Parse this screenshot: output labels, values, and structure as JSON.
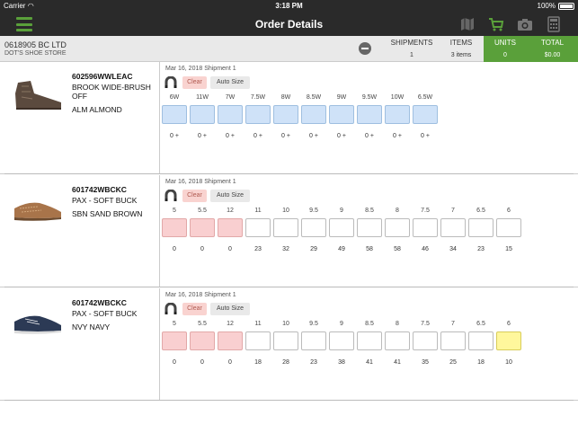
{
  "status_bar": {
    "carrier": "Carrier",
    "time": "3:18 PM",
    "battery": "100%"
  },
  "nav": {
    "title": "Order Details",
    "icons": [
      "menu-icon",
      "map-icon",
      "cart-icon",
      "camera-icon",
      "calculator-icon"
    ],
    "accent_color": "#5aa03a"
  },
  "customer": {
    "name": "0618905 BC LTD",
    "store": "DOT'S SHOE STORE",
    "shipments_label": "SHIPMENTS",
    "shipments_value": "1",
    "items_label": "ITEMS",
    "items_value": "3 items",
    "units_label": "UNITS",
    "units_value": "0",
    "total_label": "TOTAL",
    "total_value": "$0.00"
  },
  "products": [
    {
      "sku": "602596WWLEAC",
      "name": "BROOK WIDE-BRUSH OFF",
      "color": "ALM ALMOND",
      "shipment": "Mar 16, 2018 Shipment 1",
      "clear_label": "Clear",
      "auto_label": "Auto Size",
      "sizes": [
        {
          "label": "6W",
          "qty": "0 +",
          "state": "blue"
        },
        {
          "label": "11W",
          "qty": "0 +",
          "state": "blue"
        },
        {
          "label": "7W",
          "qty": "0 +",
          "state": "blue"
        },
        {
          "label": "7.5W",
          "qty": "0 +",
          "state": "blue"
        },
        {
          "label": "8W",
          "qty": "0 +",
          "state": "blue"
        },
        {
          "label": "8.5W",
          "qty": "0 +",
          "state": "blue"
        },
        {
          "label": "9W",
          "qty": "0 +",
          "state": "blue"
        },
        {
          "label": "9.5W",
          "qty": "0 +",
          "state": "blue"
        },
        {
          "label": "10W",
          "qty": "0 +",
          "state": "blue"
        },
        {
          "label": "6.5W",
          "qty": "0 +",
          "state": "blue"
        }
      ]
    },
    {
      "sku": "601742WBCKC",
      "name": "PAX - SOFT BUCK",
      "color": "SBN SAND BROWN",
      "shipment": "Mar 16, 2018 Shipment 1",
      "clear_label": "Clear",
      "auto_label": "Auto Size",
      "sizes": [
        {
          "label": "5",
          "qty": "0",
          "state": "pink"
        },
        {
          "label": "5.5",
          "qty": "0",
          "state": "pink"
        },
        {
          "label": "12",
          "qty": "0",
          "state": "pink"
        },
        {
          "label": "11",
          "qty": "23",
          "state": "white"
        },
        {
          "label": "10",
          "qty": "32",
          "state": "white"
        },
        {
          "label": "9.5",
          "qty": "29",
          "state": "white"
        },
        {
          "label": "9",
          "qty": "49",
          "state": "white"
        },
        {
          "label": "8.5",
          "qty": "58",
          "state": "white"
        },
        {
          "label": "8",
          "qty": "58",
          "state": "white"
        },
        {
          "label": "7.5",
          "qty": "46",
          "state": "white"
        },
        {
          "label": "7",
          "qty": "34",
          "state": "white"
        },
        {
          "label": "6.5",
          "qty": "23",
          "state": "white"
        },
        {
          "label": "6",
          "qty": "15",
          "state": "white"
        }
      ]
    },
    {
      "sku": "601742WBCKC",
      "name": "PAX - SOFT BUCK",
      "color": "NVY NAVY",
      "shipment": "Mar 16, 2018 Shipment 1",
      "clear_label": "Clear",
      "auto_label": "Auto Size",
      "sizes": [
        {
          "label": "5",
          "qty": "0",
          "state": "pink"
        },
        {
          "label": "5.5",
          "qty": "0",
          "state": "pink"
        },
        {
          "label": "12",
          "qty": "0",
          "state": "pink"
        },
        {
          "label": "11",
          "qty": "18",
          "state": "white"
        },
        {
          "label": "10",
          "qty": "28",
          "state": "white"
        },
        {
          "label": "9.5",
          "qty": "23",
          "state": "white"
        },
        {
          "label": "9",
          "qty": "38",
          "state": "white"
        },
        {
          "label": "8.5",
          "qty": "41",
          "state": "white"
        },
        {
          "label": "8",
          "qty": "41",
          "state": "white"
        },
        {
          "label": "7.5",
          "qty": "35",
          "state": "white"
        },
        {
          "label": "7",
          "qty": "25",
          "state": "white"
        },
        {
          "label": "6.5",
          "qty": "18",
          "state": "white"
        },
        {
          "label": "6",
          "qty": "10",
          "state": "yellow"
        }
      ]
    }
  ]
}
